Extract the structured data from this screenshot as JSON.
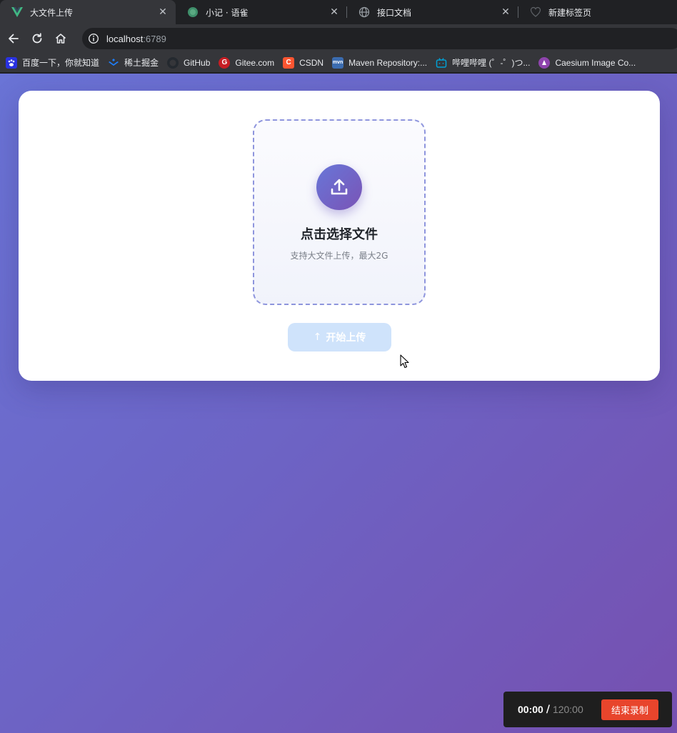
{
  "tabs": [
    {
      "title": "大文件上传",
      "icon": "vue-icon",
      "active": true
    },
    {
      "title": "小记 · 语雀",
      "icon": "yuque-icon",
      "active": false
    },
    {
      "title": "接口文档",
      "icon": "globe-icon",
      "active": false
    },
    {
      "title": "新建标签页",
      "icon": "new-tab-icon",
      "active": false
    }
  ],
  "address": {
    "host": "localhost",
    "port": ":6789"
  },
  "bookmarks": [
    {
      "label": "百度一下，你就知道",
      "icon": "baidu-icon",
      "color": "#2932e1"
    },
    {
      "label": "稀土掘金",
      "icon": "juejin-icon",
      "color": "#1e80ff"
    },
    {
      "label": "GitHub",
      "icon": "github-icon",
      "color": "#24292f"
    },
    {
      "label": "Gitee.com",
      "icon": "gitee-icon",
      "color": "#c71d23"
    },
    {
      "label": "CSDN",
      "icon": "csdn-icon",
      "color": "#fc5531"
    },
    {
      "label": "Maven Repository:...",
      "icon": "maven-icon",
      "color": "#3b6cb0"
    },
    {
      "label": "哔哩哔哩 (゜-゜)つ...",
      "icon": "bilibili-icon",
      "color": "#00a1d6"
    },
    {
      "label": "Caesium Image Co...",
      "icon": "caesium-icon",
      "color": "#8e44ad"
    }
  ],
  "upload": {
    "title": "点击选择文件",
    "subtitle": "支持大文件上传，最大2G",
    "start_button": "开始上传",
    "start_arrow": "↑"
  },
  "recorder": {
    "elapsed": "00:00",
    "separator": "/",
    "total": "120:00",
    "stop_button": "结束录制"
  },
  "colors": {
    "accent_start": "#6876d8",
    "accent_end": "#7a54b6",
    "start_button_disabled": "#cfe3fb",
    "stop_button": "#e8452c"
  }
}
